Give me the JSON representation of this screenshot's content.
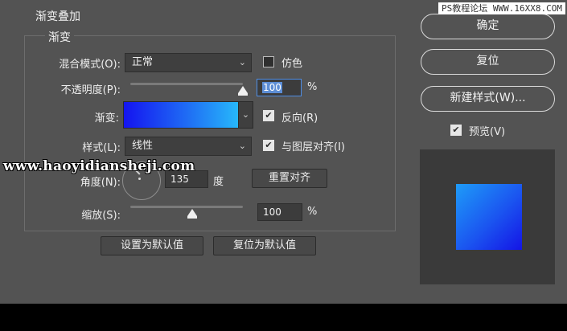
{
  "dialog": {
    "title": "渐变叠加",
    "group_title": "渐变"
  },
  "blend_mode": {
    "label": "混合模式(O):",
    "value": "正常",
    "dither_label": "仿色",
    "dither_checked": false
  },
  "opacity": {
    "label": "不透明度(P):",
    "value": "100",
    "unit": "%",
    "slider_fraction": 1.0
  },
  "gradient": {
    "label": "渐变:",
    "reverse_label": "反向(R)",
    "reverse_checked": true,
    "colors": [
      "#1414f0",
      "#27b8fa"
    ]
  },
  "style": {
    "label": "样式(L):",
    "value": "线性",
    "align_label": "与图层对齐(I)",
    "align_checked": true
  },
  "angle": {
    "label": "角度(N):",
    "value": "135",
    "unit": "度",
    "reset_align_label": "重置对齐"
  },
  "scale": {
    "label": "缩放(S):",
    "value": "100",
    "unit": "%",
    "slider_fraction": 0.55
  },
  "footer": {
    "set_default_label": "设置为默认值",
    "reset_default_label": "复位为默认值"
  },
  "side": {
    "ok_label": "确定",
    "reset_label": "复位",
    "new_style_label": "新建样式(W)...",
    "preview_label": "预览(V)",
    "preview_checked": true
  },
  "watermarks": {
    "top_right": "PS教程论坛 WWW.16XX8.COM",
    "overlay": "www.haoyidiansheji.com"
  },
  "icons": {
    "check": "✔",
    "chevron": "⌄"
  }
}
